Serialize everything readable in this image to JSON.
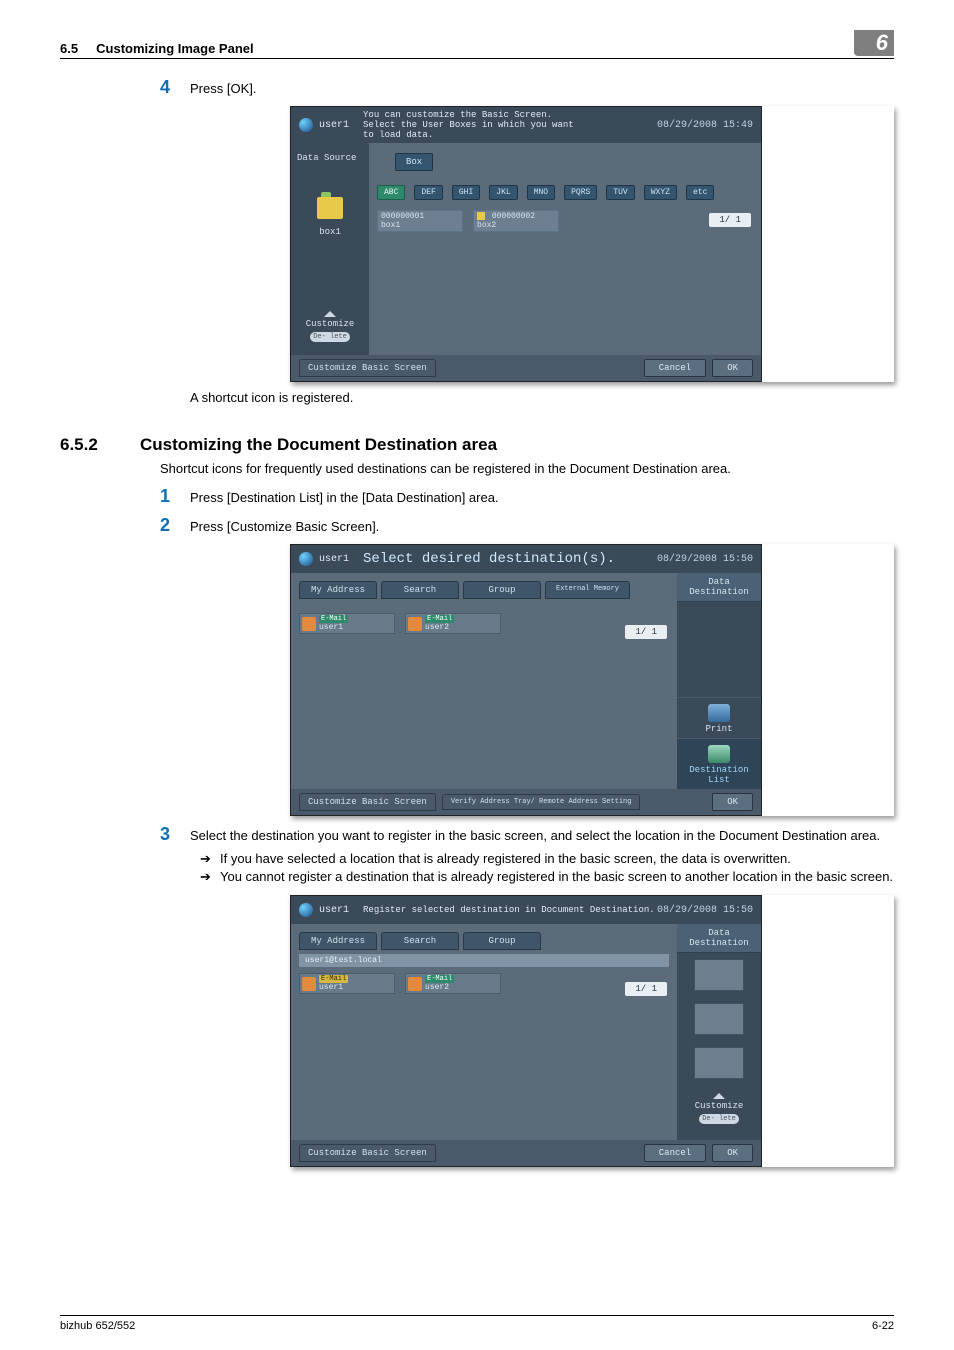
{
  "header": {
    "section_num": "6.5",
    "section_title": "Customizing Image Panel",
    "chapter_badge": "6"
  },
  "block1": {
    "step_num": "4",
    "step_text": "Press [OK].",
    "panel": {
      "user": "user1",
      "msg_line1": "You can customize the Basic Screen.",
      "msg_line2": "Select the User Boxes in which you want",
      "msg_line3": "to load data.",
      "timestamp": "08/29/2008 15:49",
      "left_label": "Data Source",
      "left_box": "box1",
      "cust_label": "Customize",
      "delete_label": "De-\nlete",
      "box_btn": "Box",
      "alpha": [
        "ABC",
        "DEF",
        "GHI",
        "JKL",
        "MNO",
        "PQRS",
        "TUV",
        "WXYZ",
        "etc"
      ],
      "boxes": [
        {
          "id": "000000001",
          "name": "box1"
        },
        {
          "id": "000000002",
          "name": "box2"
        }
      ],
      "page_ind": "1/  1",
      "footer_tab": "Customize Basic Screen",
      "btn_cancel": "Cancel",
      "btn_ok": "OK"
    },
    "after_text": "A shortcut icon is registered."
  },
  "subheading": {
    "num": "6.5.2",
    "title": "Customizing the Document Destination area"
  },
  "sub_intro": "Shortcut icons for frequently used destinations can be registered in the Document Destination area.",
  "block2": {
    "step_num": "1",
    "step_text": "Press [Destination List] in the [Data Destination] area."
  },
  "block3": {
    "step_num": "2",
    "step_text": "Press [Customize Basic Screen].",
    "panel": {
      "user": "user1",
      "msg_big": "Select desired destination(s).",
      "timestamp": "08/29/2008 15:50",
      "tabs": [
        "My Address",
        "Search",
        "Group",
        "External\nMemory"
      ],
      "dests": [
        {
          "top": "E-Mail",
          "name": "user1"
        },
        {
          "top": "E-Mail",
          "name": "user2"
        }
      ],
      "page_ind": "1/  1",
      "right_head": "Data Destination",
      "right_items": [
        {
          "label": "Print"
        },
        {
          "label": "Destination List"
        }
      ],
      "footer_tab": "Customize Basic Screen",
      "footer_tab2": "Verify Address Tray/\nRemote Address Setting",
      "btn_ok": "OK"
    }
  },
  "block4": {
    "step_num": "3",
    "step_text": "Select the destination you want to register in the basic screen, and select the location in the Document Destination area.",
    "bullets": [
      "If you have selected a location that is already registered in the basic screen, the data is overwritten.",
      "You cannot register a destination that is already registered in the basic screen to another location in the basic screen."
    ],
    "panel": {
      "user": "user1",
      "msg": "Register selected destination in Document Destination.",
      "timestamp": "08/29/2008 15:50",
      "tabs": [
        "My Address",
        "Search",
        "Group"
      ],
      "strip": "user1@test.local",
      "dests": [
        {
          "top": "E-Mail",
          "name": "user1"
        },
        {
          "top": "E-Mail",
          "name": "user2"
        }
      ],
      "page_ind": "1/  1",
      "right_head": "Data Destination",
      "cust_label": "Customize",
      "delete_label": "De-\nlete",
      "footer_tab": "Customize Basic Screen",
      "btn_cancel": "Cancel",
      "btn_ok": "OK"
    }
  },
  "footer": {
    "left": "bizhub 652/552",
    "right": "6-22"
  }
}
